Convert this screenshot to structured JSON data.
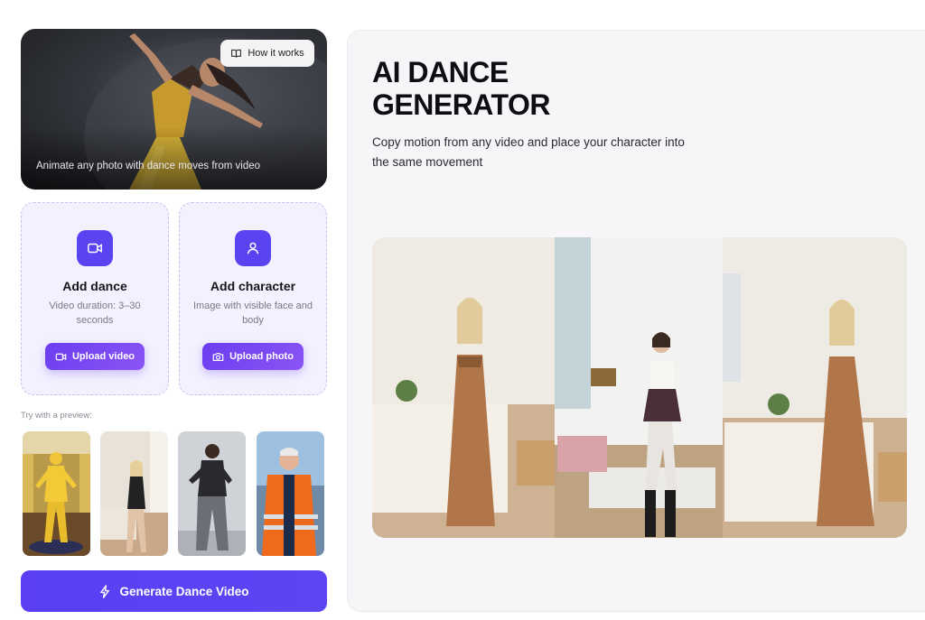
{
  "hero": {
    "how_it_works_label": "How it works",
    "caption": "Animate any photo with dance moves from video"
  },
  "add_dance": {
    "title": "Add dance",
    "description": "Video duration: 3–30 seconds",
    "button_label": "Upload video"
  },
  "add_character": {
    "title": "Add character",
    "description": "Image with visible face and body",
    "button_label": "Upload photo"
  },
  "preview": {
    "label": "Try with a preview:"
  },
  "generate_button": "Generate Dance Video",
  "main": {
    "title_line1": "AI DANCE",
    "title_line2": "GENERATOR",
    "subtitle_line1": "Copy motion from any video and place your character into",
    "subtitle_line2": "the same movement"
  },
  "colors": {
    "accent": "#5a43f0",
    "card_bg": "#f3f1fe",
    "panel_bg": "#f6f6f8"
  },
  "icons": {
    "how_it_works": "book-icon",
    "add_dance": "video-camera-icon",
    "add_character": "user-icon",
    "upload_video": "video-camera-icon",
    "upload_photo": "camera-icon",
    "generate": "lightning-icon"
  }
}
